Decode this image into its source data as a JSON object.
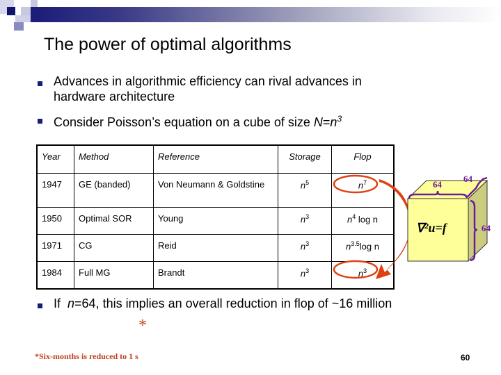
{
  "slide": {
    "title": "The power of optimal algorithms",
    "bullets": [
      {
        "line1": "Advances in algorithmic efficiency can rival advances in",
        "line2": "hardware architecture"
      },
      {
        "prefix": "Consider Poisson’s equation on a cube of size ",
        "var": "N",
        "eq": "=",
        "base": "n",
        "exp": "3"
      }
    ],
    "final_bullet": {
      "prefix": "If  ",
      "var": "n",
      "rest": "=64, this implies an overall reduction in flop of ~16 million"
    },
    "asterisk": "*",
    "footnote": "*Six-months is reduced to 1 s",
    "page_number": "60"
  },
  "table": {
    "headers": [
      "Year",
      "Method",
      "Reference",
      "Storage",
      "Flop"
    ],
    "rows": [
      {
        "year": "1947",
        "method": "GE (banded)",
        "reference": "Von Neumann & Goldstine",
        "storage": {
          "base": "n",
          "exp": "5"
        },
        "flop": {
          "base": "n",
          "exp": "7",
          "suffix": ""
        }
      },
      {
        "year": "1950",
        "method": "Optimal SOR",
        "reference": "Young",
        "storage": {
          "base": "n",
          "exp": "3"
        },
        "flop": {
          "base": "n",
          "exp": "4",
          "suffix": " log n"
        }
      },
      {
        "year": "1971",
        "method": "CG",
        "reference": "Reid",
        "storage": {
          "base": "n",
          "exp": "3"
        },
        "flop": {
          "base": "n",
          "exp": "3.5",
          "suffix": "log n"
        }
      },
      {
        "year": "1984",
        "method": "Full MG",
        "reference": "Brandt",
        "storage": {
          "base": "n",
          "exp": "3"
        },
        "flop": {
          "base": "n",
          "exp": "3",
          "suffix": ""
        }
      }
    ]
  },
  "cube": {
    "equation": "∇²u=f",
    "dim_top": "64",
    "dim_depth": "64",
    "dim_side": "64"
  },
  "colors": {
    "accent_red": "#e04010",
    "cube_face": "#ffff99",
    "cube_side": "#cccc80",
    "brace_purple": "#6a1a9a",
    "bullet_navy": "#1a1a78"
  }
}
